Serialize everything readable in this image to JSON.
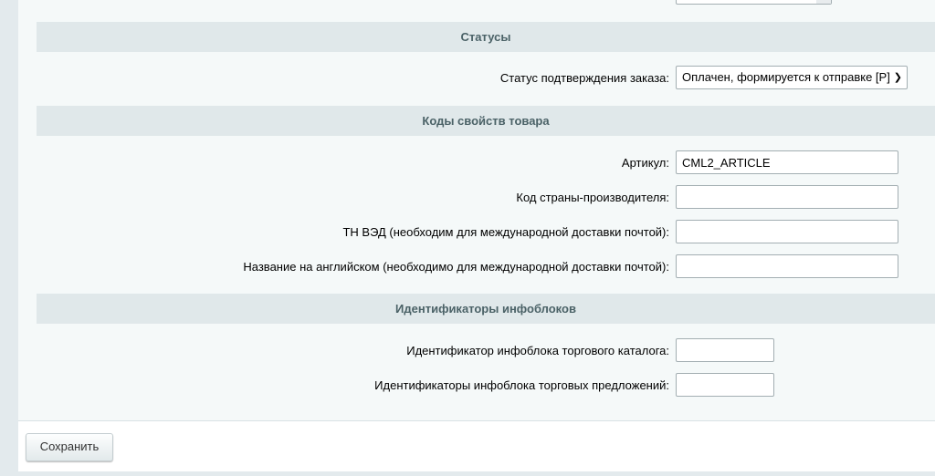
{
  "sections": {
    "statuses": {
      "title": "Статусы",
      "order_status_label": "Статус подтверждения заказа:",
      "order_status_value": "Оплачен, формируется к отправке [P]"
    },
    "property_codes": {
      "title": "Коды свойств товара",
      "fields": [
        {
          "label": "Артикул:",
          "value": "CML2_ARTICLE"
        },
        {
          "label": "Код страны-производителя:",
          "value": ""
        },
        {
          "label": "ТН ВЭД (необходим для международной доставки почтой):",
          "value": ""
        },
        {
          "label": "Название на английском (необходимо для международной доставки почтой):",
          "value": ""
        }
      ]
    },
    "iblock_ids": {
      "title": "Идентификаторы инфоблоков",
      "fields": [
        {
          "label": "Идентификатор инфоблока торгового каталога:",
          "value": ""
        },
        {
          "label": "Идентификаторы инфоблока торговых предложений:",
          "value": ""
        }
      ]
    }
  },
  "footer": {
    "save_label": "Сохранить"
  }
}
